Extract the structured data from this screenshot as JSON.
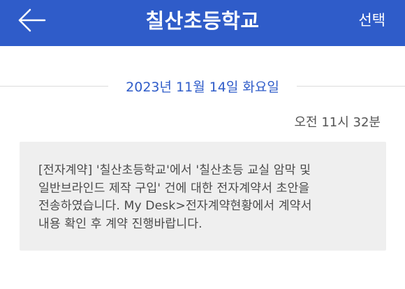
{
  "header": {
    "title": "칠산초등학교",
    "select_label": "선택",
    "back_icon": "back-arrow-icon",
    "background_color": "#2f5cc9"
  },
  "date_divider": {
    "text": "2023년 11월 14일 화요일",
    "color": "#2f5cc9"
  },
  "message": {
    "time": "오전 11시 32분",
    "lines": [
      "[전자계약] '칠산초등학교'에서 '칠산초등 교실 암막 및",
      "일반브라인드 제작 구입' 건에 대한 전자계약서 초안을",
      "전송하였습니다. My Desk>전자계약현황에서 계약서",
      "내용 확인 후 계약 진행바랍니다."
    ]
  }
}
